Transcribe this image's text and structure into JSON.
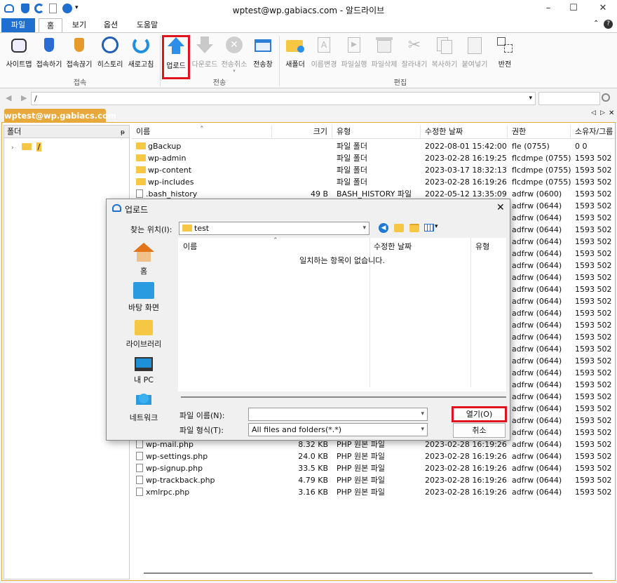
{
  "window": {
    "title": "wptest@wp.gabiacs.com - 알드라이브"
  },
  "ribbon_tabs": [
    "파일",
    "홈",
    "보기",
    "옵션",
    "도움말"
  ],
  "ribbon": {
    "connect_group": {
      "label": "접속",
      "buttons": [
        "사이트맵",
        "접속하기",
        "접속끊기",
        "히스토리",
        "새로고침"
      ]
    },
    "transfer_group": {
      "label": "전송",
      "buttons": [
        "업로드",
        "다운로드",
        "전송취소",
        "전송창"
      ]
    },
    "edit_group": {
      "label": "편집",
      "buttons": [
        "새폴더",
        "이름변경",
        "파일실행",
        "파일삭제",
        "잘라내기",
        "복사하기",
        "붙여넣기",
        "반전"
      ]
    }
  },
  "address": {
    "path": "/"
  },
  "connection_tab": "wptest@wp.gabiacs.com",
  "folder_pane": {
    "header": "폴더",
    "pin": "ᵽ",
    "root": "/"
  },
  "file_list": {
    "columns": [
      "이름",
      "크기",
      "유형",
      "수정한 날짜",
      "권한",
      "소유자/그룹"
    ],
    "rows_top": [
      {
        "name": "gBackup",
        "size": "",
        "type": "파일 폴더",
        "date": "2022-08-01 15:42:00",
        "perm": "fle (0755)",
        "owner": "0 0",
        "folder": true
      },
      {
        "name": "wp-admin",
        "size": "",
        "type": "파일 폴더",
        "date": "2023-02-28 16:19:25",
        "perm": "flcdmpe (0755)",
        "owner": "1593 502",
        "folder": true
      },
      {
        "name": "wp-content",
        "size": "",
        "type": "파일 폴더",
        "date": "2023-03-17 18:32:13",
        "perm": "flcdmpe (0755)",
        "owner": "1593 502",
        "folder": true
      },
      {
        "name": "wp-includes",
        "size": "",
        "type": "파일 폴더",
        "date": "2023-02-28 16:19:26",
        "perm": "flcdmpe (0755)",
        "owner": "1593 502",
        "folder": true
      },
      {
        "name": ".bash_history",
        "size": "49 B",
        "type": "BASH_HISTORY 파일",
        "date": "2022-05-12 13:35:09",
        "perm": "adfrw (0600)",
        "owner": "1593 502",
        "folder": false
      }
    ],
    "hidden_perm": "adfrw (0644)",
    "hidden_owner": "1593 502",
    "rows_bottom": [
      {
        "name": "wp-mail.php",
        "size": "8.32 KB",
        "type": "PHP 원본 파일",
        "date": "2023-02-28 16:19:26",
        "perm": "adfrw (0644)",
        "owner": "1593 502",
        "folder": false
      },
      {
        "name": "wp-settings.php",
        "size": "24.0 KB",
        "type": "PHP 원본 파일",
        "date": "2023-02-28 16:19:26",
        "perm": "adfrw (0644)",
        "owner": "1593 502",
        "folder": false
      },
      {
        "name": "wp-signup.php",
        "size": "33.5 KB",
        "type": "PHP 원본 파일",
        "date": "2023-02-28 16:19:26",
        "perm": "adfrw (0644)",
        "owner": "1593 502",
        "folder": false
      },
      {
        "name": "wp-trackback.php",
        "size": "4.79 KB",
        "type": "PHP 원본 파일",
        "date": "2023-02-28 16:19:26",
        "perm": "adfrw (0644)",
        "owner": "1593 502",
        "folder": false
      },
      {
        "name": "xmlrpc.php",
        "size": "3.16 KB",
        "type": "PHP 원본 파일",
        "date": "2023-02-28 16:19:26",
        "perm": "adfrw (0644)",
        "owner": "1593 502",
        "folder": false
      }
    ]
  },
  "dialog": {
    "title": "업로드",
    "lookin_label": "찾는 위치(I):",
    "lookin_value": "test",
    "sidebar": [
      "홈",
      "바탕 화면",
      "라이브러리",
      "내 PC",
      "네트워크"
    ],
    "columns": [
      "이름",
      "수정한 날짜",
      "유형"
    ],
    "empty_message": "일치하는 항목이 없습니다.",
    "filename_label": "파일 이름(N):",
    "filename_value": "",
    "filetype_label": "파일 형식(T):",
    "filetype_value": "All files and folders(*.*)",
    "open_button": "열기(O)",
    "cancel_button": "취소"
  },
  "colors": {
    "accent": "#1f6fd0",
    "tab_orange": "#e8a93c",
    "highlight_red": "#e0141e",
    "folder": "#f6c744"
  }
}
